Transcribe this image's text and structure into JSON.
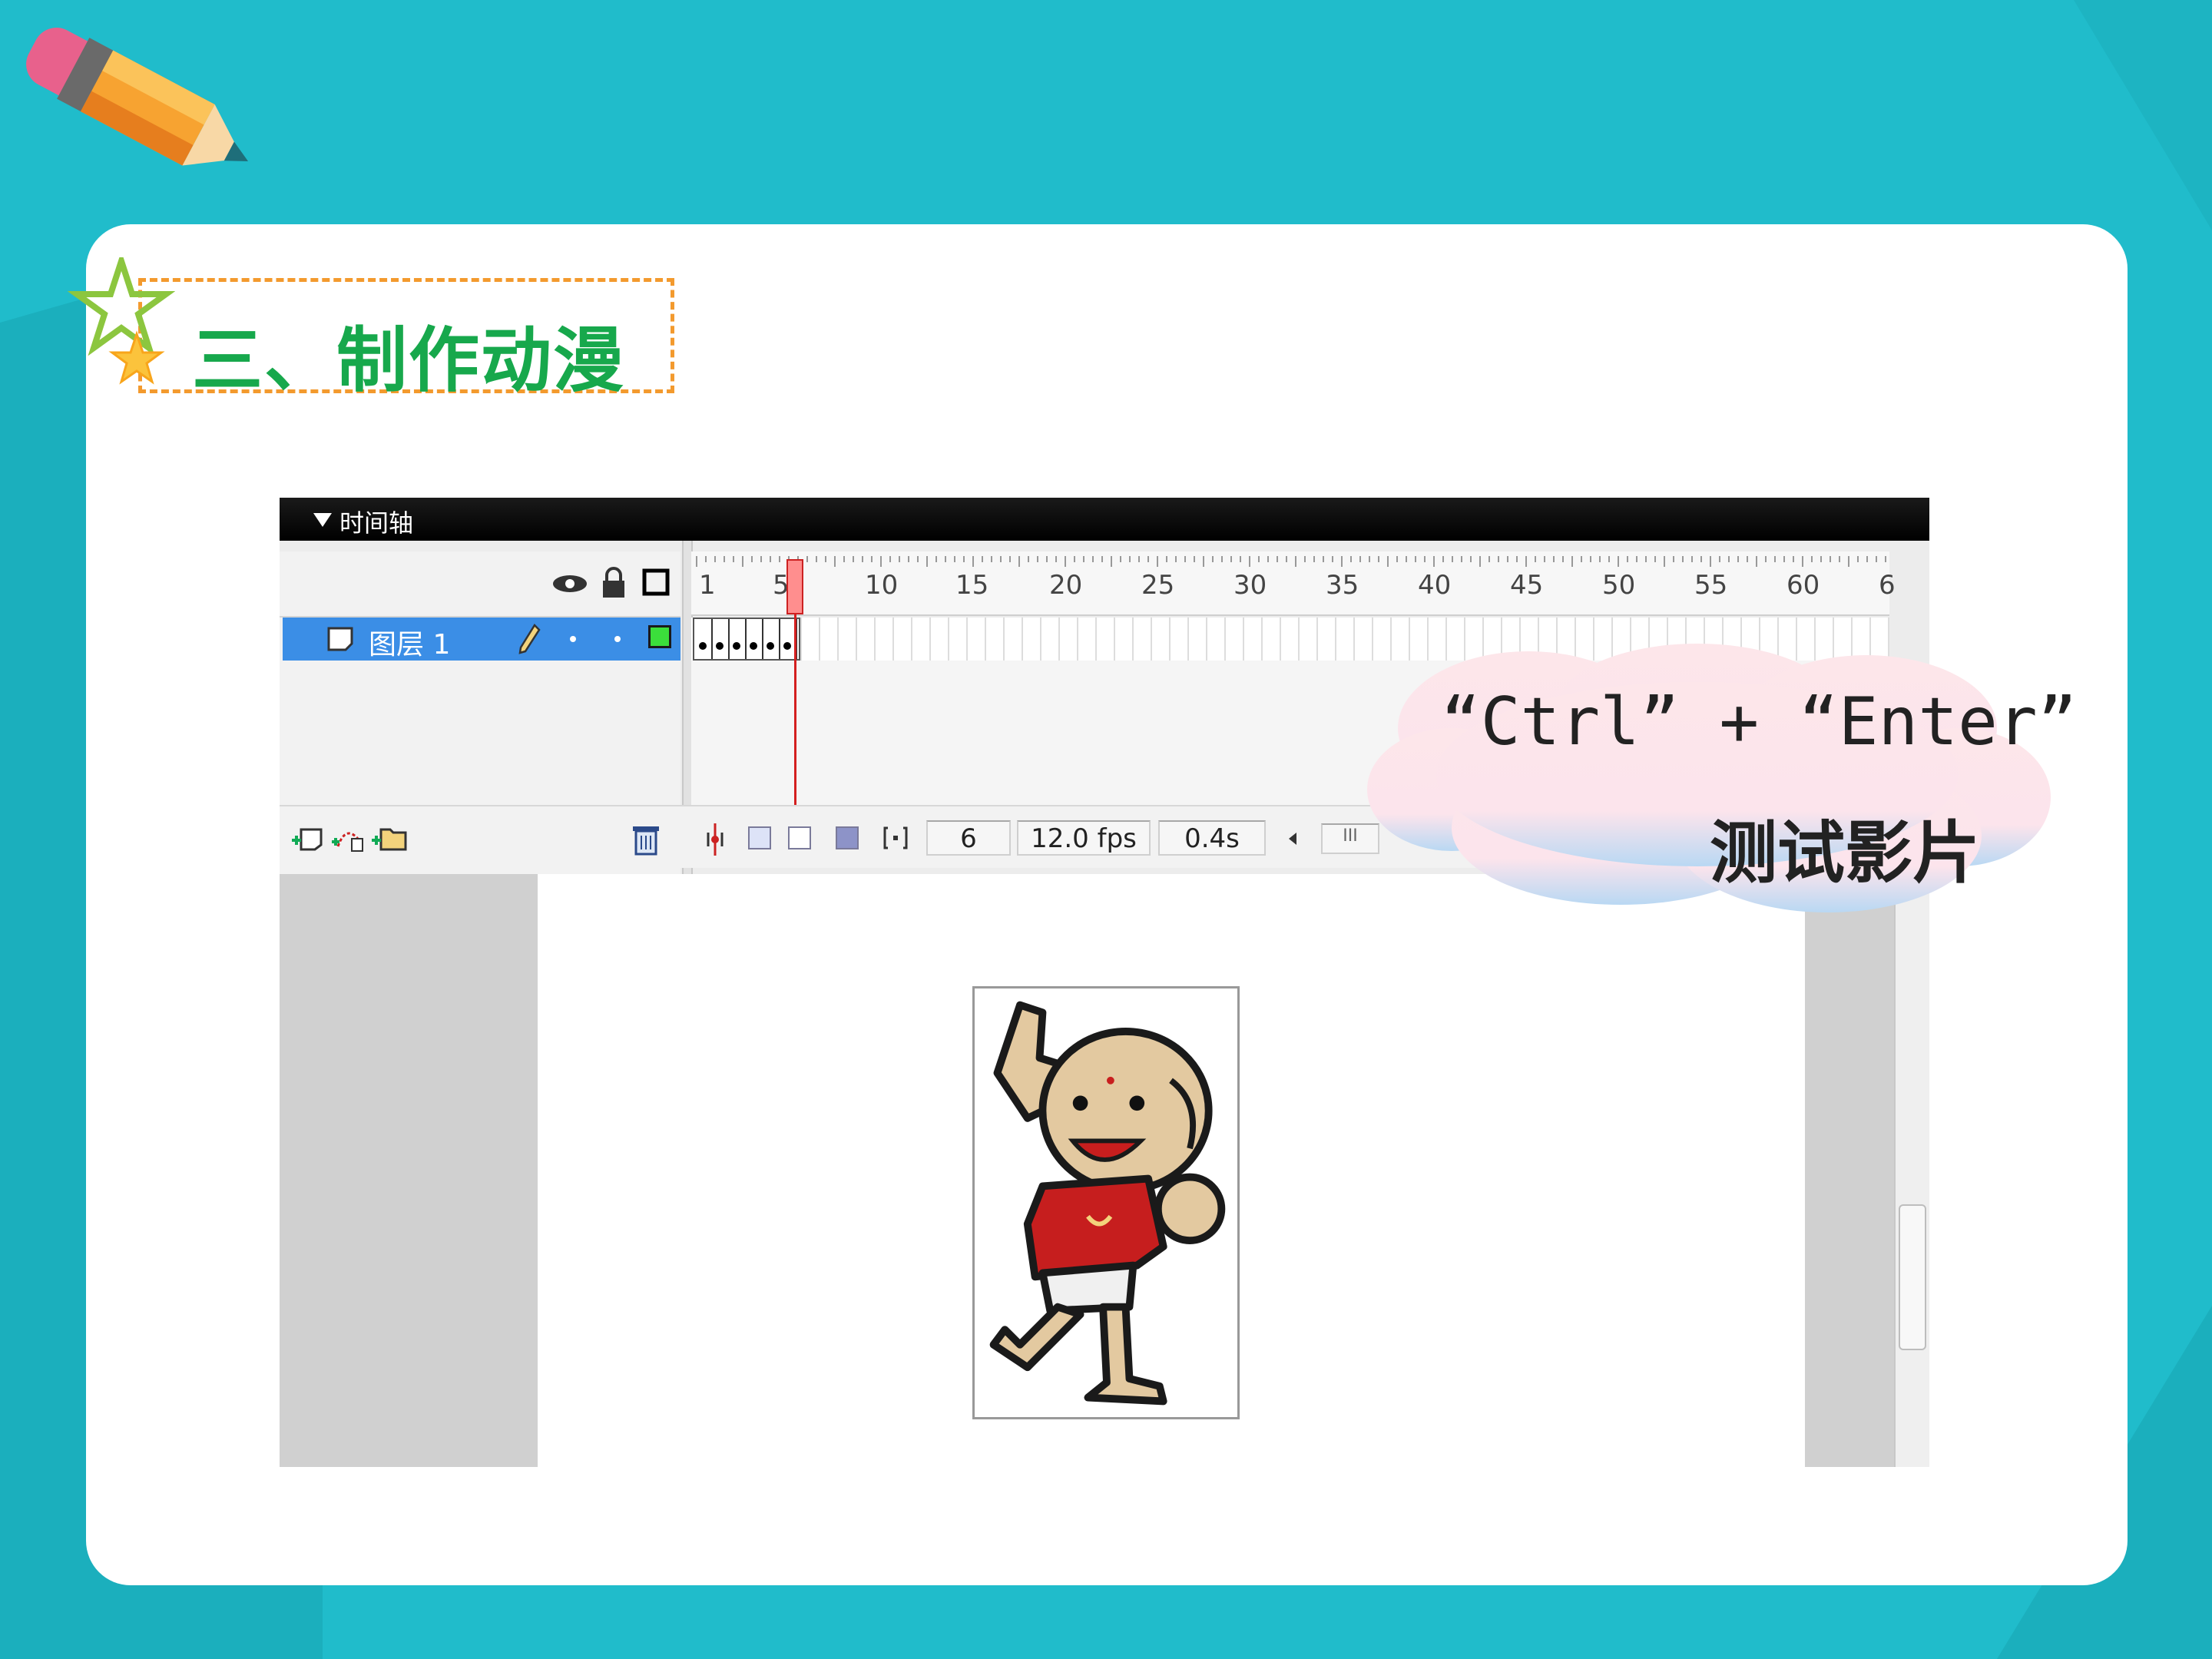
{
  "slide": {
    "heading": "三、制作动漫",
    "callout_line1": "“Ctrl” + “Enter”",
    "callout_line2": "测试影片"
  },
  "timeline": {
    "panel_title": "时间轴",
    "layer_name": "图层 1",
    "ruler_numbers": [
      "1",
      "5",
      "10",
      "15",
      "20",
      "25",
      "30",
      "35",
      "40",
      "45",
      "50",
      "55",
      "60",
      "6"
    ],
    "current_frame": "6",
    "frame_rate": "12.0 fps",
    "elapsed_time": "0.4s",
    "scroll_grip": "III"
  },
  "colors": {
    "background": "#20BCCB",
    "heading": "#17A84C",
    "heading_border": "#F39A2E",
    "layer_highlight": "#3B8EE6",
    "playhead": "#FF8E8E"
  },
  "icons": [
    "pencil-icon",
    "star-icon",
    "eye-icon",
    "lock-icon",
    "outline-icon",
    "layer-icon",
    "edit-pencil-icon",
    "insert-layer-icon",
    "motion-guide-icon",
    "insert-folder-icon",
    "trash-icon",
    "center-frame-icon",
    "onion-skin-icon",
    "onion-skin-outline-icon",
    "edit-multiple-frames-icon",
    "modify-onion-markers-icon",
    "scroll-left-icon",
    "cartoon-character"
  ]
}
